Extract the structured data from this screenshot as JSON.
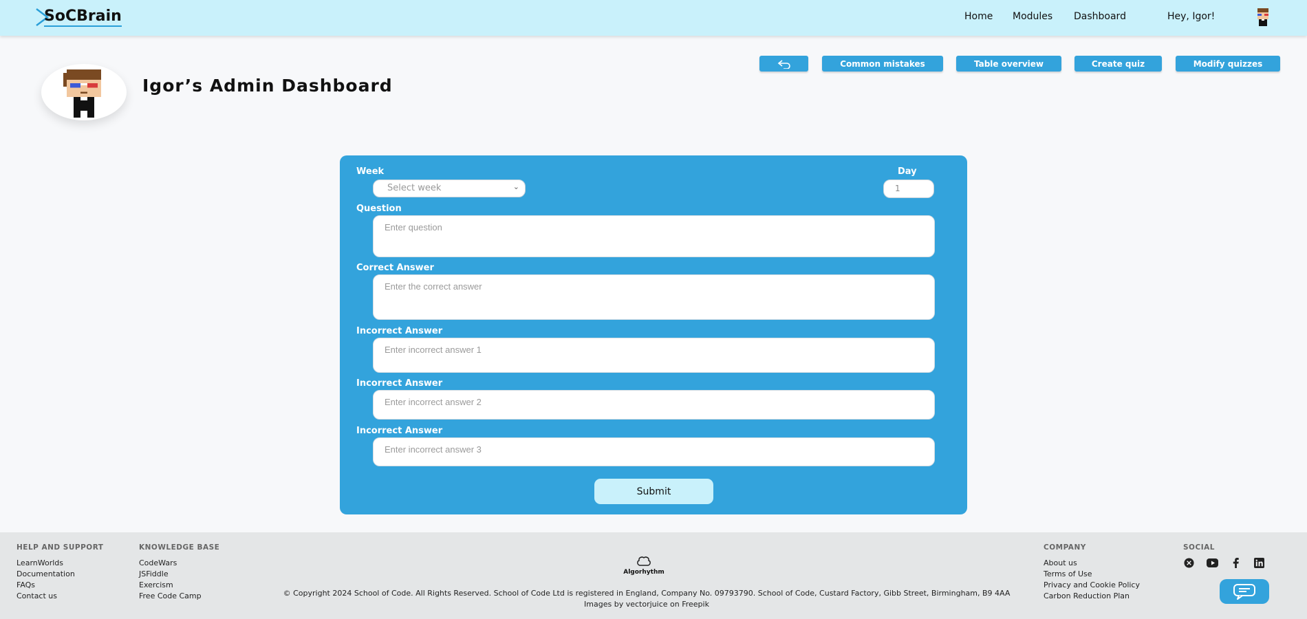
{
  "nav": {
    "logo_text": "SoCBrain",
    "links": [
      "Home",
      "Modules",
      "Dashboard"
    ],
    "greeting": "Hey, Igor!"
  },
  "header": {
    "title": "Igor’s Admin Dashboard",
    "buttons": {
      "back_icon": "undo-arrow-icon",
      "common_mistakes": "Common mistakes",
      "table_overview": "Table overview",
      "create_quiz": "Create quiz",
      "modify_quizzes": "Modify quizzes"
    }
  },
  "form": {
    "week_label": "Week",
    "week_placeholder": "Select week",
    "day_label": "Day",
    "day_value": "1",
    "question_label": "Question",
    "question_placeholder": "Enter question",
    "correct_label": "Correct Answer",
    "correct_placeholder": "Enter the correct answer",
    "incorrect_label": "Incorrect Answer",
    "incorrect_placeholders": [
      "Enter incorrect answer 1",
      "Enter incorrect answer 2",
      "Enter incorrect answer 3"
    ],
    "submit_label": "Submit"
  },
  "footer": {
    "help": {
      "heading": "HELP AND SUPPORT",
      "links": [
        "LearnWorlds",
        "Documentation",
        "FAQs",
        "Contact us"
      ]
    },
    "knowledge": {
      "heading": "KNOWLEDGE BASE",
      "links": [
        "CodeWars",
        "JSFiddle",
        "Exercism",
        "Free Code Camp"
      ]
    },
    "company": {
      "heading": "COMPANY",
      "links": [
        "About us",
        "Terms of Use",
        "Privacy and Cookie Policy",
        "Carbon Reduction Plan"
      ]
    },
    "social": {
      "heading": "SOCIAL",
      "icons": [
        "x-icon",
        "youtube-icon",
        "facebook-icon",
        "linkedin-icon"
      ]
    },
    "brand_logo_text": "Algorhythm",
    "copyright": "© Copyright 2024 School of Code. All Rights Reserved. School of Code Ltd is registered in England, Company No. 09793790. School of Code, Custard Factory, Gibb Street, Birmingham, B9 4AA",
    "images_by": "Images by vectorjuice on Freepik"
  },
  "colors": {
    "primary": "#33a3dc",
    "nav_bg": "#c9f1fb",
    "footer_bg": "#e4e6e7"
  }
}
